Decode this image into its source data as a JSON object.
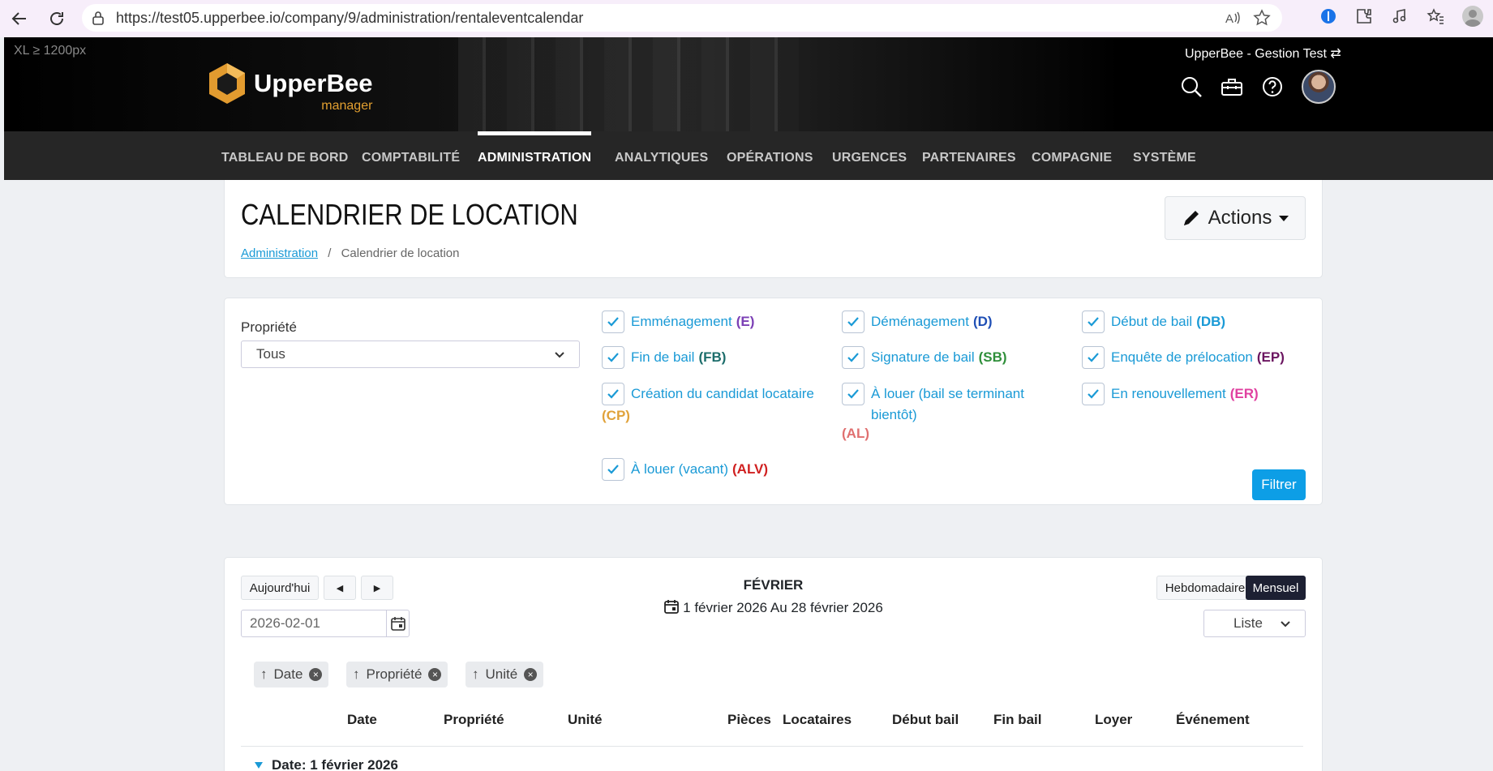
{
  "browser": {
    "url": "https://test05.upperbee.io/company/9/administration/rentaleventcalendar"
  },
  "header": {
    "breakpoint_tag": "XL ≥ 1200px",
    "logo_name": "UpperBee",
    "logo_sub": "manager",
    "company": "UpperBee - Gestion Test ⇄"
  },
  "nav": {
    "items": [
      "TABLEAU DE BORD",
      "COMPTABILITÉ",
      "ADMINISTRATION",
      "ANALYTIQUES",
      "OPÉRATIONS",
      "URGENCES",
      "PARTENAIRES",
      "COMPAGNIE",
      "SYSTÈME"
    ],
    "active": "ADMINISTRATION"
  },
  "page": {
    "title": "CALENDRIER DE LOCATION",
    "breadcrumb_link": "Administration",
    "breadcrumb_sep": "/",
    "breadcrumb_current": "Calendrier de location",
    "actions_label": "Actions"
  },
  "filters": {
    "property_label": "Propriété",
    "property_value": "Tous",
    "filter_button": "Filtrer",
    "checkboxes": [
      {
        "label": "Emménagement",
        "abbr": "(E)",
        "color": "#7b3fb5"
      },
      {
        "label": "Déménagement",
        "abbr": "(D)",
        "color": "#1f4fb5"
      },
      {
        "label": "Début de bail",
        "abbr": "(DB)",
        "color": "#1a9ad6"
      },
      {
        "label": "Fin de bail",
        "abbr": "(FB)",
        "color": "#1c6d6b"
      },
      {
        "label": "Signature de bail",
        "abbr": "(SB)",
        "color": "#2f8f3a"
      },
      {
        "label": "Enquête de prélocation",
        "abbr": "(EP)",
        "color": "#6b1560"
      },
      {
        "label": "Création du candidat locataire",
        "abbr": "(CP)",
        "color": "#e0a23a"
      },
      {
        "label": "À louer (bail se terminant bientôt)",
        "abbr": "(AL)",
        "color": "#e07070"
      },
      {
        "label": "En renouvellement",
        "abbr": "(ER)",
        "color": "#e040a0"
      },
      {
        "label": "À louer (vacant)",
        "abbr": "(ALV)",
        "color": "#d02020"
      }
    ]
  },
  "calendar": {
    "today_button": "Aujourd'hui",
    "prev_icon": "◀",
    "next_icon": "▶",
    "month": "FÉVRIER",
    "range": "1 février 2026 Au 28 février 2026",
    "date_value": "2026-02-01",
    "weekly_button": "Hebdomadaire",
    "monthly_button": "Mensuel",
    "view_select": "Liste",
    "sort_chips": [
      "Date",
      "Propriété",
      "Unité"
    ],
    "columns": [
      "Date",
      "Propriété",
      "Unité",
      "Pièces",
      "Locataires",
      "Début bail",
      "Fin bail",
      "Loyer",
      "Événement"
    ],
    "group_label": "Date: 1 février 2026"
  }
}
